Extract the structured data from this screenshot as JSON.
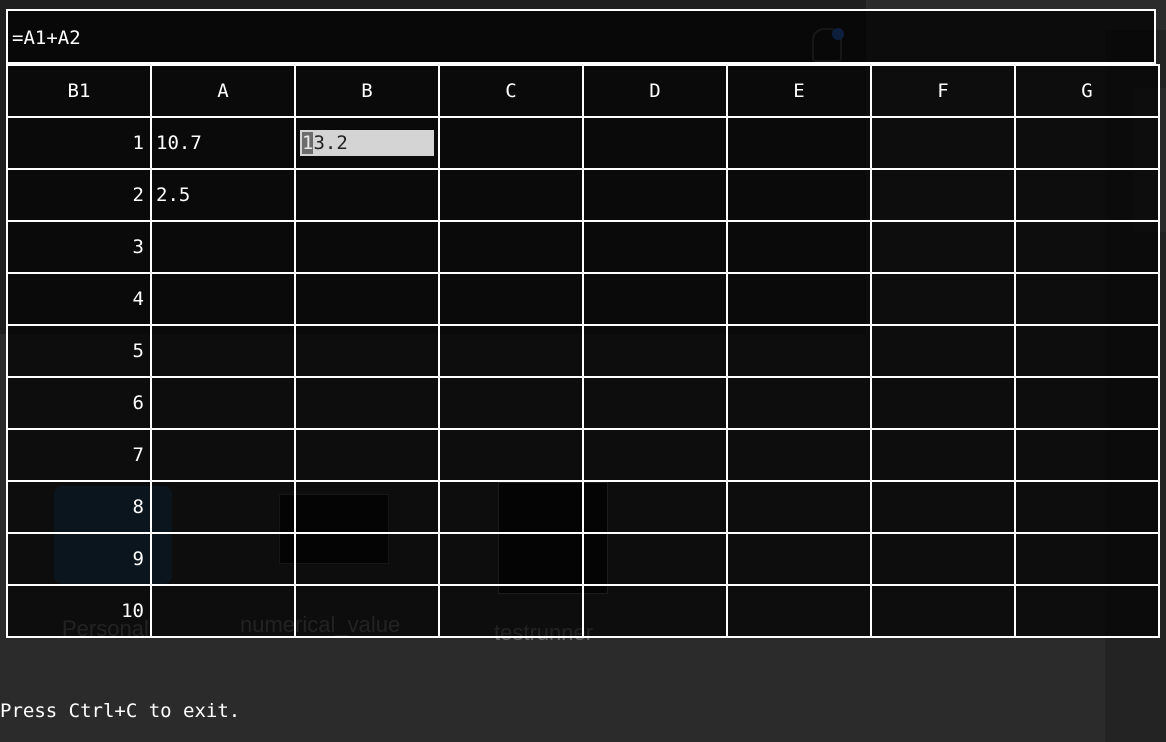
{
  "formula_bar": {
    "text": "=A1+A2"
  },
  "grid": {
    "corner": "B1",
    "columns": [
      "A",
      "B",
      "C",
      "D",
      "E",
      "F",
      "G"
    ],
    "rows": [
      {
        "label": "1",
        "cells": [
          "10.7",
          "13.2",
          "",
          "",
          "",
          "",
          ""
        ]
      },
      {
        "label": "2",
        "cells": [
          "2.5",
          "",
          "",
          "",
          "",
          "",
          ""
        ]
      },
      {
        "label": "3",
        "cells": [
          "",
          "",
          "",
          "",
          "",
          "",
          ""
        ]
      },
      {
        "label": "4",
        "cells": [
          "",
          "",
          "",
          "",
          "",
          "",
          ""
        ]
      },
      {
        "label": "5",
        "cells": [
          "",
          "",
          "",
          "",
          "",
          "",
          ""
        ]
      },
      {
        "label": "6",
        "cells": [
          "",
          "",
          "",
          "",
          "",
          "",
          ""
        ]
      },
      {
        "label": "7",
        "cells": [
          "",
          "",
          "",
          "",
          "",
          "",
          ""
        ]
      },
      {
        "label": "8",
        "cells": [
          "",
          "",
          "",
          "",
          "",
          "",
          ""
        ]
      },
      {
        "label": "9",
        "cells": [
          "",
          "",
          "",
          "",
          "",
          "",
          ""
        ]
      },
      {
        "label": "10",
        "cells": [
          "",
          "",
          "",
          "",
          "",
          "",
          ""
        ]
      }
    ],
    "selected_cell": "B1",
    "selected_value_cursor_char": "1",
    "selected_value_rest": "3.2"
  },
  "footer": {
    "hint": "Press Ctrl+C to exit."
  },
  "background": {
    "folder_label": "Personal",
    "file1_label": "numerical_value",
    "file2_label": "testrunner"
  },
  "colors": {
    "terminal_bg": "#000000",
    "grid_line": "#ffffff",
    "selection": "#d4d4d4",
    "notification_dot": "#2f6fd6"
  }
}
